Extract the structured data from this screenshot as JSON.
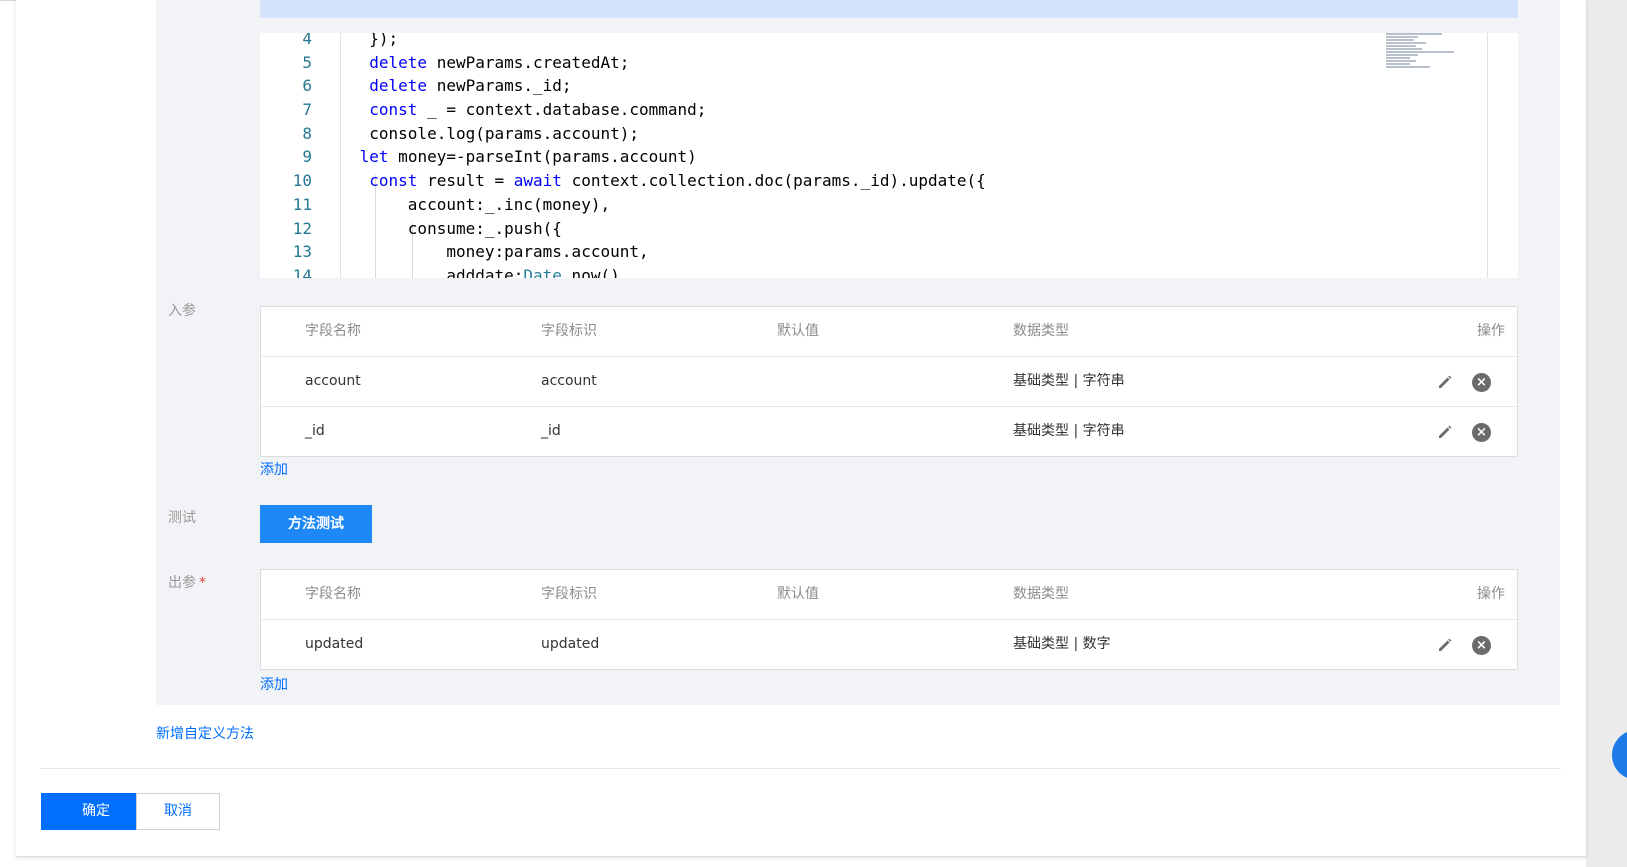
{
  "editor": {
    "lines": [
      {
        "num": "4",
        "text": "  });"
      },
      {
        "num": "5",
        "text": "  delete newParams.createdAt;"
      },
      {
        "num": "6",
        "text": "  delete newParams._id;"
      },
      {
        "num": "7",
        "text": "  const _ = context.database.command;"
      },
      {
        "num": "8",
        "text": "  console.log(params.account);"
      },
      {
        "num": "9",
        "text": " let money=-parseInt(params.account)"
      },
      {
        "num": "10",
        "text": "  const result = await context.collection.doc(params._id).update({"
      },
      {
        "num": "11",
        "text": "      account:_.inc(money),"
      },
      {
        "num": "12",
        "text": "      consume:_.push({"
      },
      {
        "num": "13",
        "text": "          money:params.account,"
      },
      {
        "num": "14",
        "text": "          adddate:Date.now()"
      }
    ]
  },
  "inputs": {
    "label": "入参",
    "headers": {
      "name": "字段名称",
      "key": "字段标识",
      "default": "默认值",
      "type": "数据类型",
      "ops": "操作"
    },
    "rows": [
      {
        "name": "account",
        "key": "account",
        "default": "",
        "type": "基础类型 | 字符串"
      },
      {
        "name": "_id",
        "key": "_id",
        "default": "",
        "type": "基础类型 | 字符串"
      }
    ],
    "add_label": "添加"
  },
  "test": {
    "label": "测试",
    "button_label": "方法测试"
  },
  "outputs": {
    "label": "出参",
    "required_mark": "*",
    "headers": {
      "name": "字段名称",
      "key": "字段标识",
      "default": "默认值",
      "type": "数据类型",
      "ops": "操作"
    },
    "rows": [
      {
        "name": "updated",
        "key": "updated",
        "default": "",
        "type": "基础类型 | 数字"
      }
    ],
    "add_label": "添加"
  },
  "add_custom_method": "新增自定义方法",
  "footer": {
    "confirm_label": "确定",
    "cancel_label": "取消"
  },
  "colors": {
    "primary": "#006eff",
    "panel_bg": "#f2f3f6",
    "editor_highlight": "#d4e3fb"
  }
}
